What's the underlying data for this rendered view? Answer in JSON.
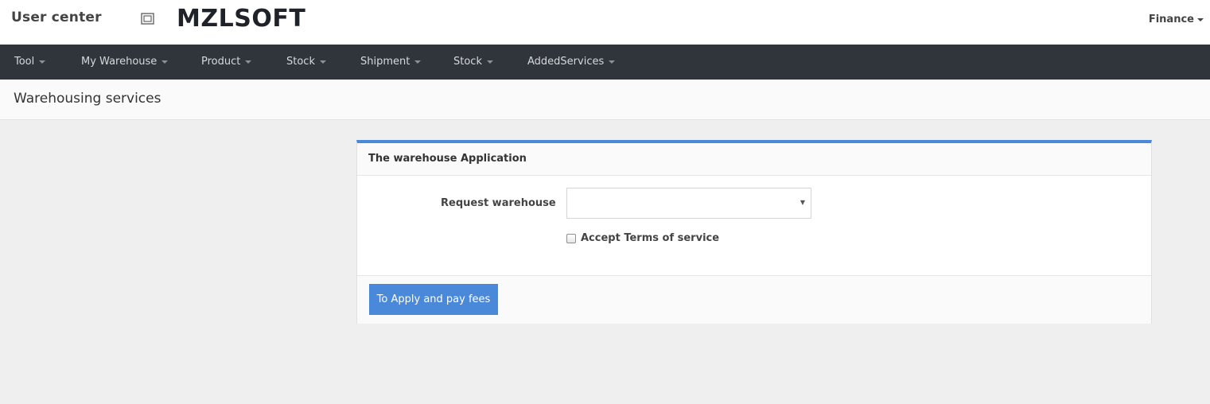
{
  "header": {
    "user_center_label": "User center",
    "brand": "MZLSOFT",
    "user_menu_label": "Finance",
    "toggle_icon": "fullscreen-toggle-icon"
  },
  "navbar": {
    "items": [
      {
        "label": "Tool"
      },
      {
        "label": "My Warehouse"
      },
      {
        "label": "Product"
      },
      {
        "label": "Stock"
      },
      {
        "label": "Shipment"
      },
      {
        "label": "Stock"
      },
      {
        "label": "AddedServices"
      }
    ]
  },
  "page": {
    "title": "Warehousing services"
  },
  "panel": {
    "title": "The warehouse Application",
    "accent_color": "#4a88da",
    "form": {
      "warehouse_label": "Request warehouse",
      "warehouse_value": "",
      "terms_label": "Accept Terms of service",
      "terms_checked": false
    },
    "submit_label": "To Apply and pay fees"
  }
}
